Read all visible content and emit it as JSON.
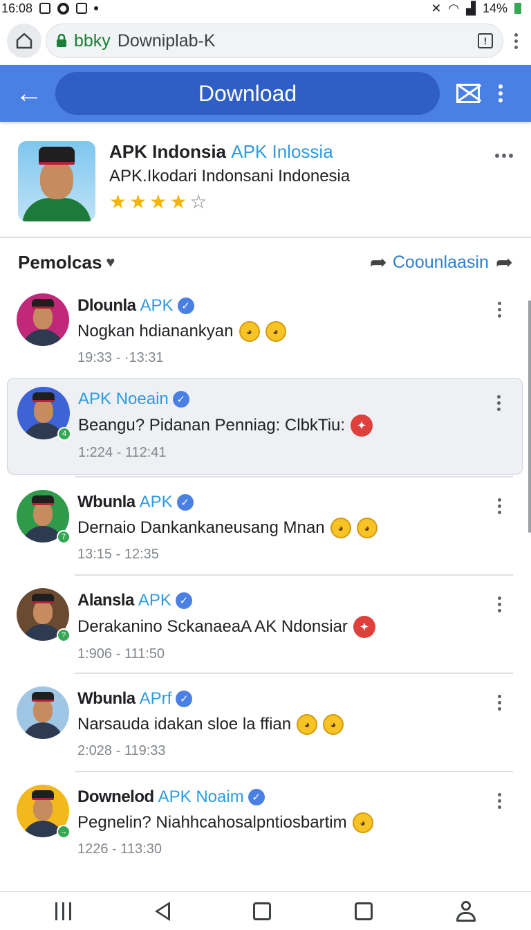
{
  "status_bar": {
    "time": "16:08",
    "battery": "14%"
  },
  "browser": {
    "url_host": "bbky",
    "url_path": "Downiplab-K"
  },
  "app_bar": {
    "title": "Download"
  },
  "app": {
    "title_main": "APK Indonsia",
    "title_highlight": "APK Inlossia",
    "subtitle": "APK.Ikodari Indonsani Indonesia",
    "rating": 4,
    "rating_max": 5
  },
  "section": {
    "title": "Pemolcas",
    "link": "Coounlaasin"
  },
  "feed": [
    {
      "name": "Dlounla",
      "name_blue": "APK",
      "message": "Nogkan hdianankyan",
      "time": "19:33 - ·13:31",
      "emojis": [
        "yellow",
        "yellow"
      ],
      "avatar_bg": "#c2287a",
      "badge": null
    },
    {
      "name": "",
      "name_blue": "APK Noeain",
      "message": "Beangu? Pidanan Penniag: ClbkTiu:",
      "time": "1:224 - 112:41",
      "emojis": [
        "red"
      ],
      "avatar_bg": "#3d63d6",
      "badge": "4"
    },
    {
      "name": "Wbunla",
      "name_blue": "APK",
      "message": "Dernaio Dankankaneusang Mnan",
      "time": "13:15 - 12:35",
      "emojis": [
        "yellow",
        "yellow"
      ],
      "avatar_bg": "#2f9a4a",
      "badge": "7"
    },
    {
      "name": "Alansla",
      "name_blue": "APK",
      "message": "Derakanino SckanaeaA AK Ndonsiar",
      "time": "1:906 - 111:50",
      "emojis": [
        "red"
      ],
      "avatar_bg": "#6b4a32",
      "badge": "?"
    },
    {
      "name": "Wbunla",
      "name_blue": "APrf",
      "message": "Narsauda idakan sloe la ffian",
      "time": "2:028 - 119:33",
      "emojis": [
        "yellow",
        "yellow"
      ],
      "avatar_bg": "#9fc6e4",
      "badge": null
    },
    {
      "name": "Downelod",
      "name_blue": "APK Noaim",
      "message": "Pegnelin? Niahhcahosalpntiosbartim",
      "time": "1226 - 113:30",
      "emojis": [
        "yellow"
      ],
      "avatar_bg": "#f2b81c",
      "badge": "→"
    }
  ],
  "colors": {
    "accent": "#4a80e3",
    "link": "#2d9be0",
    "star": "#f4b400"
  },
  "icons": {
    "status": [
      "notification-icon",
      "settings-icon",
      "storage-icon",
      "dot-icon",
      "close-icon",
      "wifi-icon",
      "signal-icon",
      "battery-icon"
    ],
    "nav": [
      "recents-icon",
      "back-icon",
      "home-icon",
      "overview-icon",
      "profile-icon"
    ]
  }
}
